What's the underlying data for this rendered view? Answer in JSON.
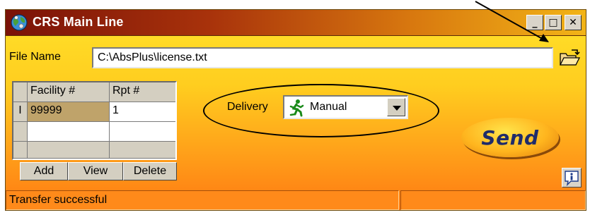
{
  "window": {
    "title": "CRS Main Line"
  },
  "titlebar_buttons": {
    "minimize": "_",
    "maximize": "□",
    "close": "✕"
  },
  "file": {
    "label": "File Name",
    "value": "C:\\AbsPlus\\license.txt"
  },
  "grid": {
    "headers": [
      "Facility #",
      "Rpt #"
    ],
    "rows": [
      {
        "indicator": "I",
        "facility": "99999",
        "rpt": "1"
      },
      {
        "indicator": "",
        "facility": "",
        "rpt": ""
      }
    ],
    "buttons": {
      "add": "Add",
      "view": "View",
      "delete": "Delete"
    }
  },
  "delivery": {
    "label": "Delivery",
    "value": "Manual"
  },
  "send": {
    "label": "Send"
  },
  "status": {
    "message": "Transfer successful",
    "secondary": ""
  },
  "icons": {
    "app": "globe-icon",
    "folder": "open-folder-icon",
    "runner": "running-man-icon",
    "info": "info-icon"
  },
  "colors": {
    "title_start": "#7a1208",
    "title_end": "#f2b417",
    "body_top": "#ffe22a",
    "body_bottom": "#ff7a12",
    "send_text": "#1f2c6a"
  }
}
